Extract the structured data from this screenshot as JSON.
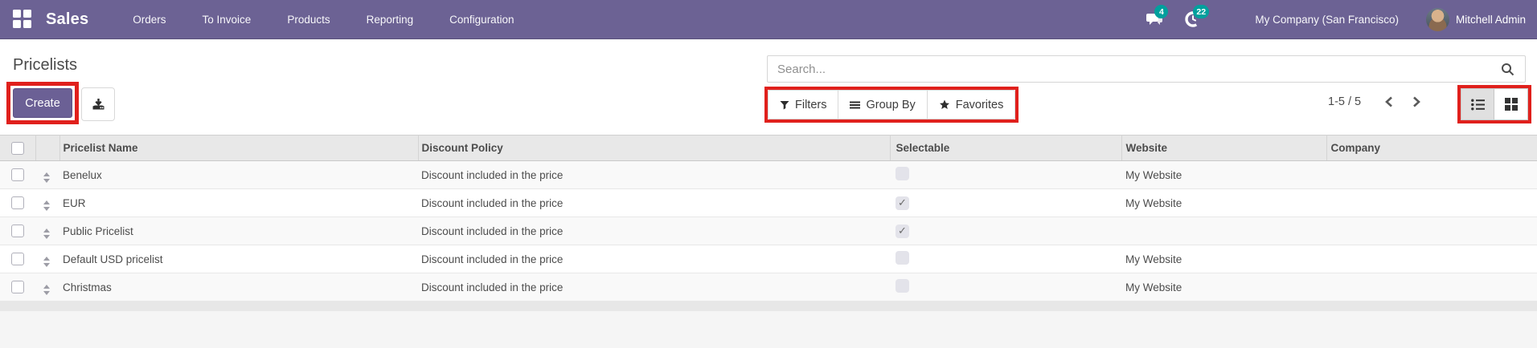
{
  "navbar": {
    "app_name": "Sales",
    "menu_items": [
      "Orders",
      "To Invoice",
      "Products",
      "Reporting",
      "Configuration"
    ],
    "messages_badge": "4",
    "activities_badge": "22",
    "company": "My Company (San Francisco)",
    "user": "Mitchell Admin"
  },
  "page": {
    "title": "Pricelists",
    "create_label": "Create"
  },
  "search": {
    "placeholder": "Search..."
  },
  "filter_bar": {
    "filters_label": "Filters",
    "group_by_label": "Group By",
    "favorites_label": "Favorites"
  },
  "pager": {
    "range": "1-5 / 5"
  },
  "table": {
    "columns": [
      "Pricelist Name",
      "Discount Policy",
      "Selectable",
      "Website",
      "Company"
    ],
    "rows": [
      {
        "name": "Benelux",
        "discount_policy": "Discount included in the price",
        "selectable": false,
        "website": "My Website",
        "company": ""
      },
      {
        "name": "EUR",
        "discount_policy": "Discount included in the price",
        "selectable": true,
        "website": "My Website",
        "company": ""
      },
      {
        "name": "Public Pricelist",
        "discount_policy": "Discount included in the price",
        "selectable": true,
        "website": "",
        "company": ""
      },
      {
        "name": "Default USD pricelist",
        "discount_policy": "Discount included in the price",
        "selectable": false,
        "website": "My Website",
        "company": ""
      },
      {
        "name": "Christmas",
        "discount_policy": "Discount included in the price",
        "selectable": false,
        "website": "My Website",
        "company": ""
      }
    ]
  },
  "colors": {
    "navbar_purple": "#6c6294",
    "primary_button": "#6b6095",
    "badge_teal": "#00a09d",
    "annotation_red": "#e0201c"
  }
}
